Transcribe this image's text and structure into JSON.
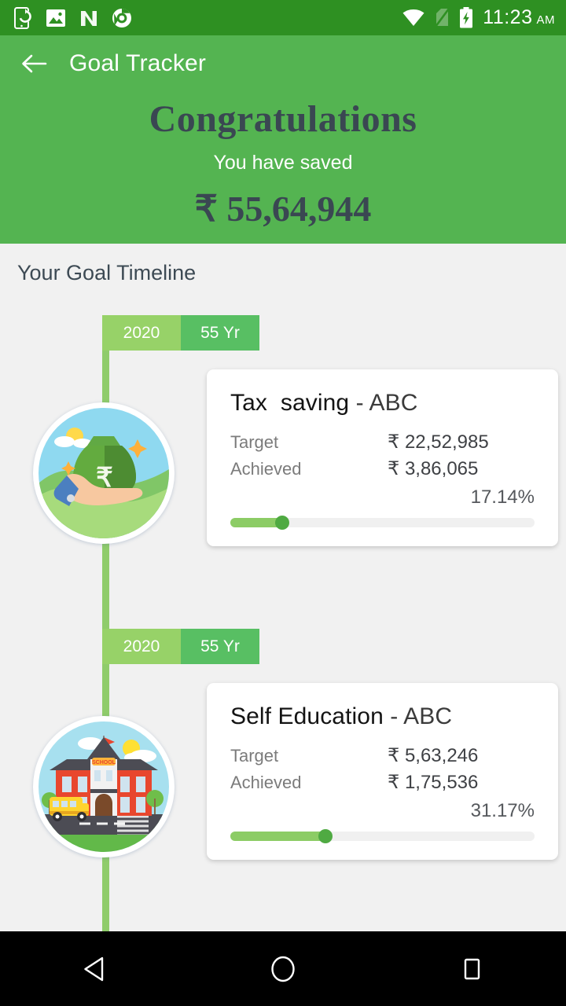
{
  "status_bar": {
    "notification_icons": [
      "phone-sync-icon",
      "image-icon",
      "nova-n-icon",
      "chrome-icon"
    ],
    "system_icons": [
      "wifi-icon",
      "no-sim-icon",
      "battery-charging-icon"
    ],
    "time": "11:23",
    "meridiem": "AM",
    "background_color": "#2e9022"
  },
  "app_bar": {
    "back_icon": "back-arrow-icon",
    "title": "Goal Tracker",
    "background_color": "#54b451"
  },
  "hero": {
    "heading": "Congratulations",
    "subheading": "You have saved",
    "amount": "₹ 55,64,944",
    "heading_color": "#3a4752"
  },
  "timeline": {
    "section_title": "Your Goal Timeline",
    "rail_color": "#8fcc6b",
    "entries": [
      {
        "year": "2020",
        "age": "55 Yr",
        "illustration": "money-bag-in-hand-icon",
        "card": {
          "title": "Tax  saving",
          "title_suffix": " - ABC",
          "target_label": "Target",
          "target_value": "₹ 22,52,985",
          "achieved_label": "Achieved",
          "achieved_value": "₹ 3,86,065",
          "percent_label": "17.14%",
          "percent_value": 17.14
        }
      },
      {
        "year": "2020",
        "age": "55 Yr",
        "illustration": "school-building-icon",
        "card": {
          "title": "Self Education",
          "title_suffix": " - ABC",
          "target_label": "Target",
          "target_value": "₹ 5,63,246",
          "achieved_label": "Achieved",
          "achieved_value": "₹ 1,75,536",
          "percent_label": "31.17%",
          "percent_value": 31.17
        }
      }
    ]
  },
  "nav_bar": {
    "back": "nav-back-icon",
    "home": "nav-home-icon",
    "recents": "nav-recents-icon"
  }
}
